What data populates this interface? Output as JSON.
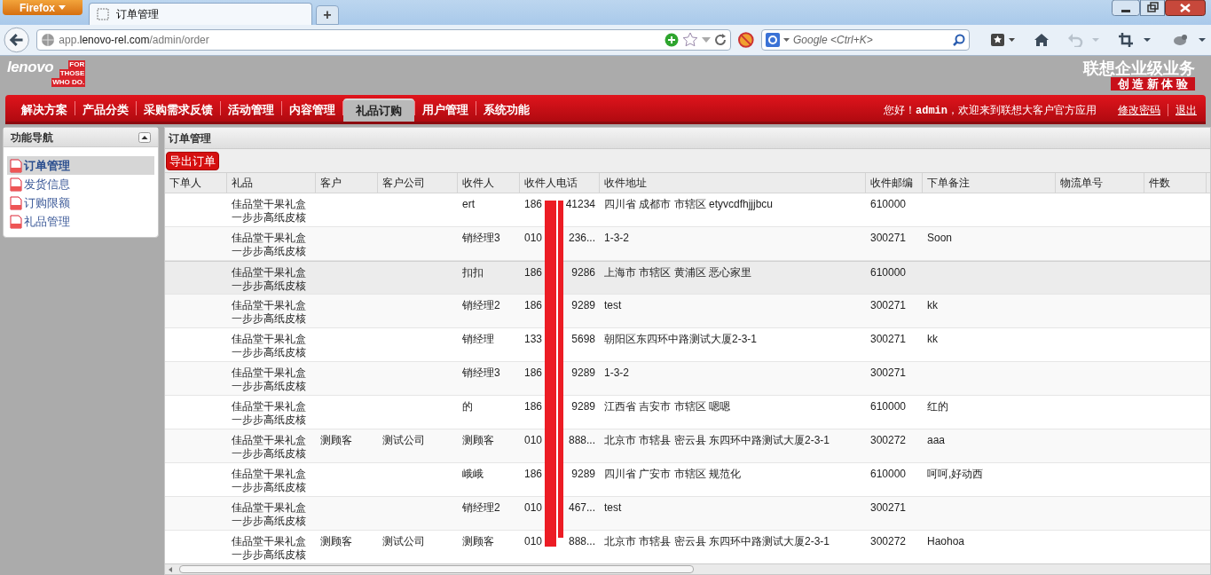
{
  "browser": {
    "menu_button": "Firefox",
    "tabs": [
      {
        "title": "订单管理",
        "selected": true
      }
    ],
    "new_tab": "+",
    "url": "app.**lenovo-rel.com**/admin/order",
    "search": {
      "placeholder": "Google <Ctrl+K>"
    }
  },
  "header": {
    "logo": "lenovo",
    "tagline": [
      "FOR",
      "THOSE",
      "WHO DO."
    ],
    "brand_title": "联想企业级业务",
    "slogan": "创 造 新 体 验"
  },
  "nav": {
    "items": [
      {
        "label": "解决方案",
        "selected": false
      },
      {
        "label": "产品分类",
        "selected": false
      },
      {
        "label": "采购需求反馈",
        "selected": false
      },
      {
        "label": "活动管理",
        "selected": false
      },
      {
        "label": "内容管理",
        "selected": false
      },
      {
        "label": "礼品订购",
        "selected": true
      },
      {
        "label": "用户管理",
        "selected": false
      },
      {
        "label": "系统功能",
        "selected": false
      }
    ],
    "welcome": "您好！**admin**，欢迎来到联想大客户官方应用",
    "links": [
      "修改密码",
      "退出"
    ]
  },
  "sidebar": {
    "title": "功能导航",
    "items": [
      {
        "label": "订单管理",
        "selected": true
      },
      {
        "label": "发货信息",
        "selected": false
      },
      {
        "label": "订购限额",
        "selected": false
      },
      {
        "label": "礼品管理",
        "selected": false
      }
    ]
  },
  "panel": {
    "title": "订单管理",
    "export_button": "导出订单"
  },
  "table": {
    "columns": [
      "下单人",
      "礼品",
      "客户",
      "客户公司",
      "收件人",
      "收件人电话",
      "收件地址",
      "收件邮编",
      "下单备注",
      "物流单号",
      "件数"
    ],
    "rows": [
      {
        "selected": false,
        "gift": [
          "佳品堂干果礼盒",
          "一步步高纸皮核"
        ],
        "customer": "",
        "company": "",
        "recipient": "ert",
        "phone": [
          "186",
          "41234"
        ],
        "address": "四川省 成都市 市辖区 etyvcdfhjjjbcu",
        "zip": "610000",
        "note": ""
      },
      {
        "selected": false,
        "gift": [
          "佳品堂干果礼盒",
          "一步步高纸皮核"
        ],
        "customer": "",
        "company": "",
        "recipient": "销经理3",
        "phone": [
          "010",
          "236..."
        ],
        "address": "1-3-2",
        "zip": "300271",
        "note": "Soon"
      },
      {
        "selected": true,
        "gift": [
          "佳品堂干果礼盒",
          "一步步高纸皮核"
        ],
        "customer": "",
        "company": "",
        "recipient": "扣扣",
        "phone": [
          "186",
          "9286"
        ],
        "address": "上海市 市辖区 黄浦区 恶心家里",
        "zip": "610000",
        "note": ""
      },
      {
        "selected": false,
        "gift": [
          "佳品堂干果礼盒",
          "一步步高纸皮核"
        ],
        "customer": "",
        "company": "",
        "recipient": "销经理2",
        "phone": [
          "186",
          "9289"
        ],
        "address": "test",
        "zip": "300271",
        "note": "kk"
      },
      {
        "selected": false,
        "gift": [
          "佳品堂干果礼盒",
          "一步步高纸皮核"
        ],
        "customer": "",
        "company": "",
        "recipient": "销经理",
        "phone": [
          "133",
          "5698"
        ],
        "address": "朝阳区东四环中路测试大厦2-3-1",
        "zip": "300271",
        "note": "kk"
      },
      {
        "selected": false,
        "gift": [
          "佳品堂干果礼盒",
          "一步步高纸皮核"
        ],
        "customer": "",
        "company": "",
        "recipient": "销经理3",
        "phone": [
          "186",
          "9289"
        ],
        "address": "1-3-2",
        "zip": "300271",
        "note": ""
      },
      {
        "selected": false,
        "gift": [
          "佳品堂干果礼盒",
          "一步步高纸皮核"
        ],
        "customer": "",
        "company": "",
        "recipient": "的",
        "phone": [
          "186",
          "9289"
        ],
        "address": "江西省 吉安市 市辖区 嗯嗯",
        "zip": "610000",
        "note": "红的"
      },
      {
        "selected": false,
        "gift": [
          "佳品堂干果礼盒",
          "一步步高纸皮核"
        ],
        "customer": "测顾客",
        "company": "测试公司",
        "recipient": "测顾客",
        "phone": [
          "010",
          "888..."
        ],
        "address": "北京市 市辖县 密云县 东四环中路测试大厦2-3-1",
        "zip": "300272",
        "note": "aaa"
      },
      {
        "selected": false,
        "gift": [
          "佳品堂干果礼盒",
          "一步步高纸皮核"
        ],
        "customer": "",
        "company": "",
        "recipient": "峨峨",
        "phone": [
          "186",
          "9289"
        ],
        "address": "四川省 广安市 市辖区 规范化",
        "zip": "610000",
        "note": "呵呵,好动西"
      },
      {
        "selected": false,
        "gift": [
          "佳品堂干果礼盒",
          "一步步高纸皮核"
        ],
        "customer": "",
        "company": "",
        "recipient": "销经理2",
        "phone": [
          "010",
          "467..."
        ],
        "address": "test",
        "zip": "300271",
        "note": ""
      },
      {
        "selected": false,
        "gift": [
          "佳品堂干果礼盒",
          "一步步高纸皮核"
        ],
        "customer": "测顾客",
        "company": "测试公司",
        "recipient": "测顾客",
        "phone": [
          "010",
          "888..."
        ],
        "address": "北京市 市辖县 密云县 东四环中路测试大厦2-3-1",
        "zip": "300272",
        "note": "Haohoa"
      }
    ]
  }
}
